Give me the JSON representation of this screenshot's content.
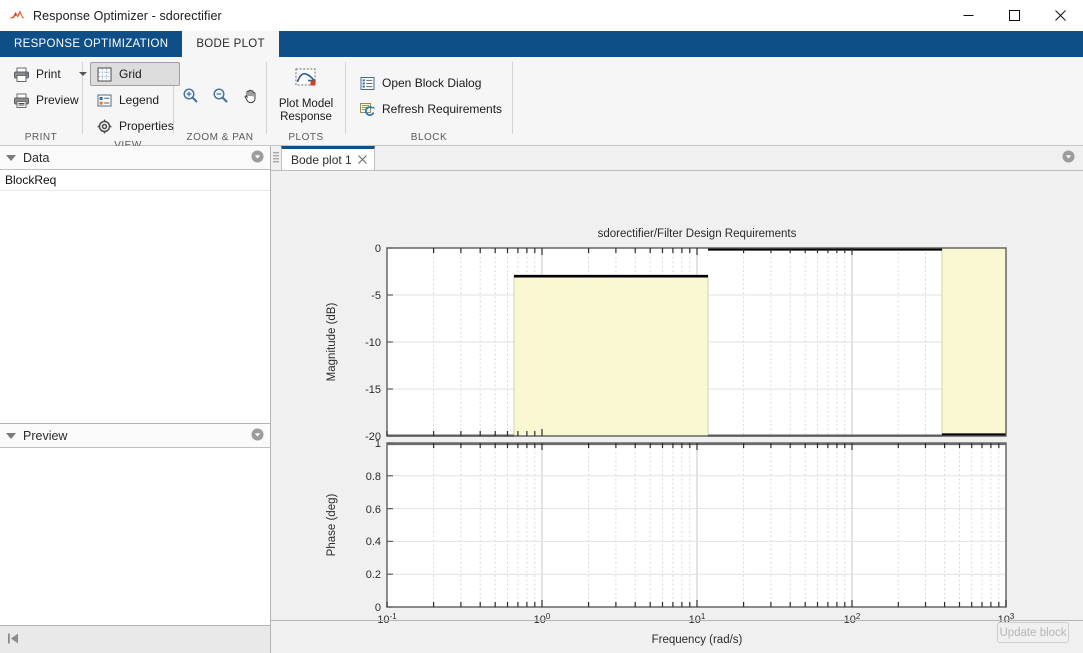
{
  "window": {
    "title": "Response Optimizer - sdorectifier",
    "icon": "matlab-logo-icon",
    "minimize_label": "—",
    "maximize_label": "□",
    "close_label": "✕"
  },
  "ribbon": {
    "tabs": [
      {
        "label": "RESPONSE OPTIMIZATION",
        "active": false
      },
      {
        "label": "BODE PLOT",
        "active": true
      }
    ],
    "groups": [
      {
        "name": "print",
        "label": "PRINT",
        "items": [
          {
            "label": "Print",
            "icon": "printer-icon",
            "has_dropdown": true
          },
          {
            "label": "Preview",
            "icon": "print-preview-icon",
            "has_dropdown": false
          }
        ]
      },
      {
        "name": "view",
        "label": "VIEW",
        "items": [
          {
            "label": "Grid",
            "icon": "grid-icon",
            "toggled": true
          },
          {
            "label": "Legend",
            "icon": "legend-icon",
            "toggled": false
          },
          {
            "label": "Properties",
            "icon": "properties-gear-icon",
            "toggled": false
          }
        ]
      },
      {
        "name": "zoom-pan",
        "label": "ZOOM & PAN",
        "items": [
          {
            "label": "Zoom In",
            "icon": "zoom-in-icon"
          },
          {
            "label": "Zoom Out",
            "icon": "zoom-out-icon"
          },
          {
            "label": "Pan",
            "icon": "pan-hand-icon"
          }
        ]
      },
      {
        "name": "plots",
        "label": "PLOTS",
        "items": [
          {
            "label_line1": "Plot Model",
            "label_line2": "Response",
            "icon": "plot-model-response-icon"
          }
        ]
      },
      {
        "name": "block",
        "label": "BLOCK",
        "items": [
          {
            "label": "Open Block Dialog",
            "icon": "block-dialog-icon"
          },
          {
            "label": "Refresh Requirements",
            "icon": "refresh-requirements-icon"
          }
        ]
      }
    ],
    "collapse_icon": "collapse-ribbon-icon"
  },
  "sidebar": {
    "data_panel": {
      "title": "Data",
      "menu_icon": "panel-menu-icon",
      "expander_icon": "triangle-down-icon",
      "items": [
        {
          "label": "BlockReq"
        }
      ]
    },
    "preview_panel": {
      "title": "Preview",
      "menu_icon": "panel-menu-icon",
      "expander_icon": "triangle-down-icon",
      "items": []
    },
    "status_icon": "collapse-left-icon"
  },
  "document": {
    "grip_icon": "tab-grip-icon",
    "tabs": [
      {
        "label": "Bode plot 1",
        "close_icon": "close-tab-icon",
        "active": true
      }
    ],
    "tab_menu_icon": "document-menu-icon",
    "update_block_button": {
      "label": "Update block",
      "enabled": false
    }
  },
  "chart_data": {
    "type": "line",
    "title": "sdorectifier/Filter Design Requirements",
    "xlabel": "Frequency  (rad/s)",
    "xscale": "log",
    "xlim": [
      0.1,
      1000
    ],
    "x_ticks": [
      {
        "value": 0.1,
        "label_mantissa": "10",
        "label_exponent": "-1"
      },
      {
        "value": 1,
        "label_mantissa": "10",
        "label_exponent": "0"
      },
      {
        "value": 10,
        "label_mantissa": "10",
        "label_exponent": "1"
      },
      {
        "value": 100,
        "label_mantissa": "10",
        "label_exponent": "2"
      },
      {
        "value": 1000,
        "label_mantissa": "10",
        "label_exponent": "3"
      }
    ],
    "subplots": [
      {
        "name": "magnitude",
        "ylabel": "Magnitude (dB)",
        "ylim": [
          -20,
          0
        ],
        "y_ticks": [
          0,
          -5,
          -10,
          -15,
          -20
        ],
        "y_tick_labels": [
          "0",
          "-5",
          "-10",
          "-15",
          "-20"
        ],
        "grid": true,
        "requirement_bands": [
          {
            "name": "passband",
            "x_range": [
              0.55,
              11.0
            ],
            "y_range": [
              -20,
              -3
            ],
            "fill_color": "#faf8d2",
            "edge_color": "#000000",
            "bound_line": {
              "type": "upper",
              "y": -3,
              "x_range": [
                0.55,
                11.0
              ]
            }
          },
          {
            "name": "stopband",
            "x_range": [
              400,
              1000
            ],
            "y_range": [
              -20,
              0
            ],
            "fill_color": "#faf8d2",
            "edge_color": "#000000",
            "bound_line": {
              "type": "lower",
              "y": -20,
              "x_range": [
                400,
                1000
              ]
            }
          }
        ],
        "top_bound_line": {
          "y": 0,
          "x_range": [
            11.0,
            400
          ],
          "comment": "0 dB upper bound segment"
        }
      },
      {
        "name": "phase",
        "ylabel": "Phase (deg)",
        "ylim": [
          0,
          1
        ],
        "y_ticks": [
          0,
          0.2,
          0.4,
          0.6,
          0.8,
          1
        ],
        "y_tick_labels": [
          "0",
          "0.2",
          "0.4",
          "0.6",
          "0.8",
          "1"
        ],
        "grid": true,
        "requirement_bands": [],
        "series": []
      }
    ],
    "legend": {
      "visible": false
    },
    "colors": {
      "band_fill": "#faf8d2",
      "band_edge": "#cfcf9a",
      "bound_line": "#000000",
      "axes_bg": "#ffffff",
      "figure_bg": "#f0f0f0",
      "grid": "#e6e6e6"
    }
  }
}
